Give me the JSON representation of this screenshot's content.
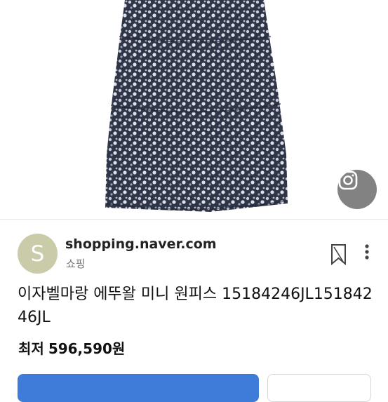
{
  "result": {
    "image_alt_icon": "camera-lens-icon",
    "source": {
      "avatar_letter": "S",
      "domain": "shopping.naver.com",
      "category": "쇼핑"
    },
    "title": "이자벨마랑 에뚜왈 미니 원피스 15184246JL15184246JL",
    "price": {
      "label": "최저",
      "value": "596,590원"
    }
  },
  "icons": {
    "bookmark": "bookmark-icon",
    "more": "more-vertical-icon"
  },
  "colors": {
    "avatar": "#c9cba9",
    "primary_button": "#3f7bd8",
    "dress_base": "#2d3446"
  }
}
